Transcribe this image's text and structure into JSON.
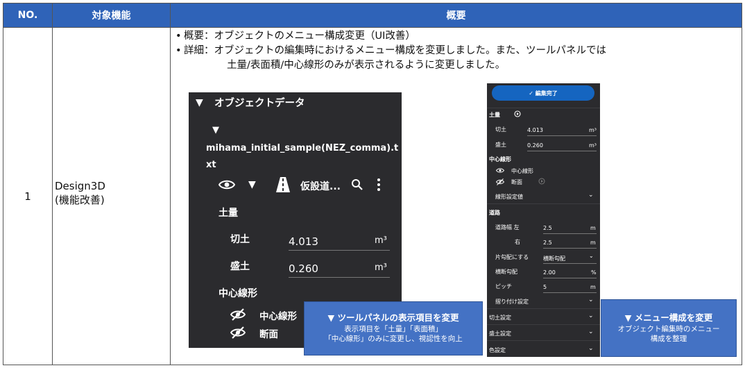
{
  "table": {
    "header": {
      "no": "NO.",
      "function": "対象機能",
      "overview": "概要"
    },
    "row": {
      "no": "1",
      "function_line1": "Design3D",
      "function_line2": "(機能改善)"
    }
  },
  "summary": {
    "bullet": "•",
    "line1": "概要：オブジェクトのメニュー構成変更（UI改善）",
    "line2": "詳細：オブジェクトの編集時におけるメニュー構成を変更しました。また、ツールパネルでは",
    "line3": "土量/表面積/中心線形のみが表示されるように変更しました。"
  },
  "left_panel": {
    "triangle": "▼",
    "object_data": "オブジェクトデータ",
    "file_name_line1": "mihama_initial_sample(NEZ_comma).t",
    "file_name_line2": "xt",
    "layer_name": "仮設道...",
    "volume_section": "土量",
    "cut_label": "切土",
    "cut_value": "4.013",
    "fill_label": "盛土",
    "fill_value": "0.260",
    "unit": "m³",
    "centerline_section": "中心線形",
    "centerline_item": "中心線形",
    "section_item": "断面"
  },
  "right_panel": {
    "done_button": "✓ 編集完了",
    "volume": "土量",
    "cut_label": "切土",
    "cut_value": "4.013",
    "fill_label": "盛土",
    "fill_value": "0.260",
    "unit_m3": "m³",
    "centerline": "中心線形",
    "centerline_item": "中心線形",
    "section_item": "断面",
    "alignment_settings": "線形設定値",
    "road": "道路",
    "road_width_label": "道路幅 左",
    "road_width_left": "2.5",
    "right_label": "右",
    "road_width_right": "2.5",
    "unit_m": "m",
    "one_side_slope": "片勾配にする",
    "one_side_slope_value": "横断勾配",
    "cross_slope_label": "横断勾配",
    "cross_slope_value": "2.00",
    "unit_pct": "%",
    "pitch_label": "ピッチ",
    "pitch_value": "5",
    "attach_settings": "摺り付け設定",
    "cut_settings": "切土設定",
    "fill_settings": "盛土設定",
    "color_settings": "色設定"
  },
  "callout_left": {
    "title": "▼ ツールパネルの表示項目を変更",
    "line1": "表示項目を「土量」「表面積」",
    "line2": "「中心線形」のみに変更し、視認性を向上"
  },
  "callout_right": {
    "title": "▼ メニュー構成を変更",
    "line1": "オブジェクト編集時のメニュー",
    "line2": "構成を整理"
  },
  "colors": {
    "header": "#2f63b8",
    "panel": "#2b2b2e",
    "callout": "#4472c4",
    "button": "#1565c0"
  }
}
